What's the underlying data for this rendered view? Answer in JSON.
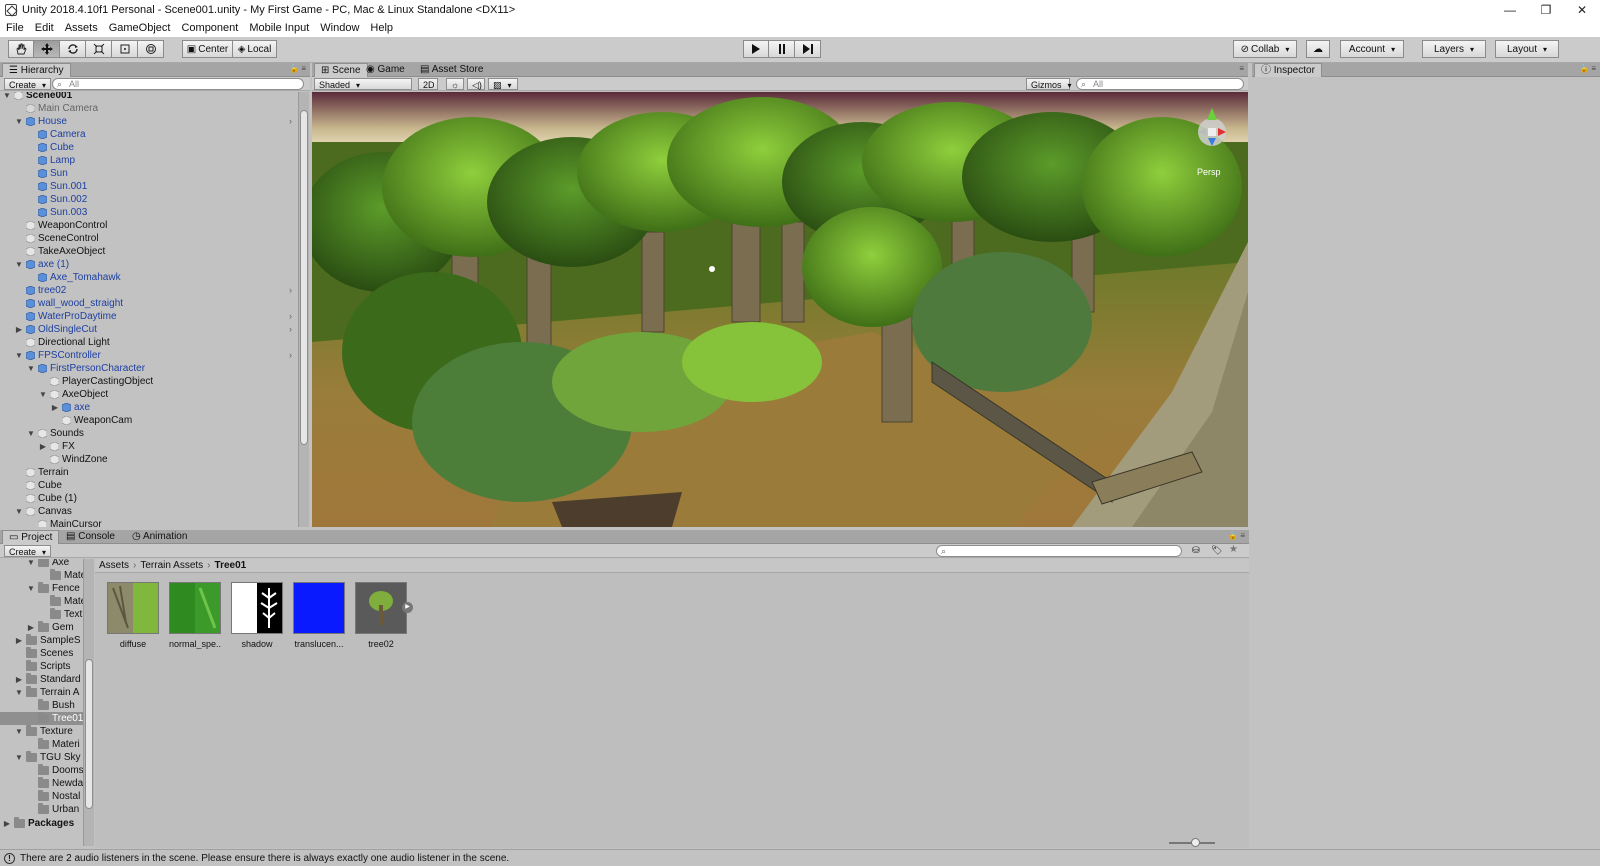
{
  "window": {
    "title": "Unity 2018.4.10f1 Personal - Scene001.unity - My First Game - PC, Mac & Linux Standalone <DX11>",
    "minimize": "—",
    "maximize": "❐",
    "close": "✕"
  },
  "menu": [
    "File",
    "Edit",
    "Assets",
    "GameObject",
    "Component",
    "Mobile Input",
    "Window",
    "Help"
  ],
  "toolbar": {
    "pivot": "Center",
    "space": "Local",
    "collab": "Collab",
    "account": "Account",
    "layers": "Layers",
    "layout": "Layout"
  },
  "hierarchy": {
    "tab": "Hierarchy",
    "create": "Create",
    "search_placeholder": "All",
    "items": [
      {
        "label": "Scene001",
        "depth": 0,
        "arrow": "open",
        "kind": "scene"
      },
      {
        "label": "Main Camera",
        "depth": 1,
        "arrow": "",
        "kind": "dim"
      },
      {
        "label": "House",
        "depth": 1,
        "arrow": "open",
        "kind": "prefab",
        "more": true
      },
      {
        "label": "Camera",
        "depth": 2,
        "arrow": "",
        "kind": "prefab"
      },
      {
        "label": "Cube",
        "depth": 2,
        "arrow": "",
        "kind": "prefab"
      },
      {
        "label": "Lamp",
        "depth": 2,
        "arrow": "",
        "kind": "prefab"
      },
      {
        "label": "Sun",
        "depth": 2,
        "arrow": "",
        "kind": "prefab"
      },
      {
        "label": "Sun.001",
        "depth": 2,
        "arrow": "",
        "kind": "prefab"
      },
      {
        "label": "Sun.002",
        "depth": 2,
        "arrow": "",
        "kind": "prefab"
      },
      {
        "label": "Sun.003",
        "depth": 2,
        "arrow": "",
        "kind": "prefab"
      },
      {
        "label": "WeaponControl",
        "depth": 1,
        "arrow": "",
        "kind": "normal"
      },
      {
        "label": "SceneControl",
        "depth": 1,
        "arrow": "",
        "kind": "normal"
      },
      {
        "label": "TakeAxeObject",
        "depth": 1,
        "arrow": "",
        "kind": "normal"
      },
      {
        "label": "axe (1)",
        "depth": 1,
        "arrow": "open",
        "kind": "prefab"
      },
      {
        "label": "Axe_Tomahawk",
        "depth": 2,
        "arrow": "",
        "kind": "prefab"
      },
      {
        "label": "tree02",
        "depth": 1,
        "arrow": "",
        "kind": "prefab",
        "more": true
      },
      {
        "label": "wall_wood_straight",
        "depth": 1,
        "arrow": "",
        "kind": "prefab"
      },
      {
        "label": "WaterProDaytime",
        "depth": 1,
        "arrow": "",
        "kind": "prefab",
        "more": true
      },
      {
        "label": "OldSingleCut",
        "depth": 1,
        "arrow": "closed",
        "kind": "prefab",
        "more": true
      },
      {
        "label": "Directional Light",
        "depth": 1,
        "arrow": "",
        "kind": "normal"
      },
      {
        "label": "FPSController",
        "depth": 1,
        "arrow": "open",
        "kind": "prefab",
        "more": true
      },
      {
        "label": "FirstPersonCharacter",
        "depth": 2,
        "arrow": "open",
        "kind": "prefab"
      },
      {
        "label": "PlayerCastingObject",
        "depth": 3,
        "arrow": "",
        "kind": "normal"
      },
      {
        "label": "AxeObject",
        "depth": 3,
        "arrow": "open",
        "kind": "normal"
      },
      {
        "label": "axe",
        "depth": 4,
        "arrow": "closed",
        "kind": "prefab"
      },
      {
        "label": "WeaponCam",
        "depth": 4,
        "arrow": "",
        "kind": "normal"
      },
      {
        "label": "Sounds",
        "depth": 2,
        "arrow": "open",
        "kind": "normal"
      },
      {
        "label": "FX",
        "depth": 3,
        "arrow": "closed",
        "kind": "normal"
      },
      {
        "label": "WindZone",
        "depth": 3,
        "arrow": "",
        "kind": "normal"
      },
      {
        "label": "Terrain",
        "depth": 1,
        "arrow": "",
        "kind": "normal"
      },
      {
        "label": "Cube",
        "depth": 1,
        "arrow": "",
        "kind": "normal"
      },
      {
        "label": "Cube (1)",
        "depth": 1,
        "arrow": "",
        "kind": "normal"
      },
      {
        "label": "Canvas",
        "depth": 1,
        "arrow": "open",
        "kind": "normal"
      },
      {
        "label": "MainCursor",
        "depth": 2,
        "arrow": "",
        "kind": "normal"
      }
    ]
  },
  "scene": {
    "tab_scene": "Scene",
    "tab_game": "Game",
    "tab_store": "Asset Store",
    "shading": "Shaded",
    "mode_2d": "2D",
    "gizmos": "Gizmos",
    "search_placeholder": "All",
    "persp": "Persp"
  },
  "inspector": {
    "tab": "Inspector"
  },
  "project": {
    "tab_project": "Project",
    "tab_console": "Console",
    "tab_animation": "Animation",
    "create": "Create",
    "breadcrumb": [
      "Assets",
      "Terrain Assets",
      "Tree01"
    ],
    "folders": [
      {
        "label": "Axe",
        "depth": 2,
        "arrow": "open"
      },
      {
        "label": "Mate",
        "depth": 3,
        "arrow": ""
      },
      {
        "label": "Fence",
        "depth": 2,
        "arrow": "open"
      },
      {
        "label": "Mate",
        "depth": 3,
        "arrow": ""
      },
      {
        "label": "Text",
        "depth": 3,
        "arrow": ""
      },
      {
        "label": "Gem",
        "depth": 2,
        "arrow": "closed"
      },
      {
        "label": "SampleS",
        "depth": 1,
        "arrow": "closed"
      },
      {
        "label": "Scenes",
        "depth": 1,
        "arrow": ""
      },
      {
        "label": "Scripts",
        "depth": 1,
        "arrow": ""
      },
      {
        "label": "Standard",
        "depth": 1,
        "arrow": "closed"
      },
      {
        "label": "Terrain A",
        "depth": 1,
        "arrow": "open"
      },
      {
        "label": "Bush",
        "depth": 2,
        "arrow": ""
      },
      {
        "label": "Tree01",
        "depth": 2,
        "arrow": "",
        "selected": true
      },
      {
        "label": "Texture",
        "depth": 1,
        "arrow": "open"
      },
      {
        "label": "Materi",
        "depth": 2,
        "arrow": ""
      },
      {
        "label": "TGU Sky",
        "depth": 1,
        "arrow": "open"
      },
      {
        "label": "Dooms",
        "depth": 2,
        "arrow": ""
      },
      {
        "label": "Newda",
        "depth": 2,
        "arrow": ""
      },
      {
        "label": "Nostal",
        "depth": 2,
        "arrow": ""
      },
      {
        "label": "Urban",
        "depth": 2,
        "arrow": ""
      }
    ],
    "packages": "Packages",
    "assets": [
      {
        "name": "diffuse",
        "type": "diffuse"
      },
      {
        "name": "normal_spe...",
        "type": "normal"
      },
      {
        "name": "shadow",
        "type": "shadow"
      },
      {
        "name": "translucen...",
        "type": "translucency"
      },
      {
        "name": "tree02",
        "type": "tree"
      }
    ]
  },
  "status": {
    "message": "There are 2 audio listeners in the scene. Please ensure there is always exactly one audio listener in the scene."
  }
}
